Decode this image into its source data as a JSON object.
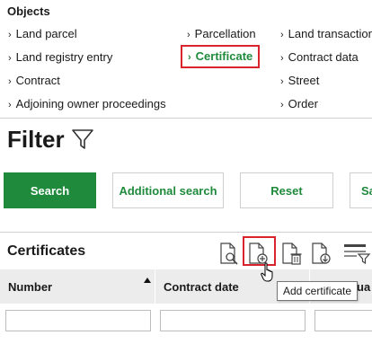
{
  "objects": {
    "heading": "Objects",
    "items": [
      {
        "label": "Land parcel"
      },
      {
        "label": "Parcellation"
      },
      {
        "label": "Land transaction"
      },
      {
        "label": "Land registry entry"
      },
      {
        "label": "Certificate"
      },
      {
        "label": "Contract data"
      },
      {
        "label": "Contract"
      },
      {
        "label": "Street"
      },
      {
        "label": "Adjoining owner proceedings"
      },
      {
        "label": "Order"
      }
    ],
    "chevron": "›"
  },
  "filter": {
    "title": "Filter",
    "buttons": {
      "search": "Search",
      "additional_search": "Additional search",
      "reset": "Reset",
      "save_partial": "Sa"
    }
  },
  "certificates": {
    "title": "Certificates",
    "toolbar_icons": [
      "view-document-icon",
      "add-document-icon",
      "delete-document-icon",
      "download-document-icon",
      "filter-list-icon"
    ],
    "columns": [
      {
        "label": "Number",
        "sort": "ascending"
      },
      {
        "label": "Contract date"
      },
      {
        "label": "ua"
      }
    ],
    "tooltip": "Add certificate"
  },
  "colors": {
    "accent_green": "#1f8a3c",
    "highlight_red": "#d9232d",
    "header_gray": "#ececec"
  }
}
